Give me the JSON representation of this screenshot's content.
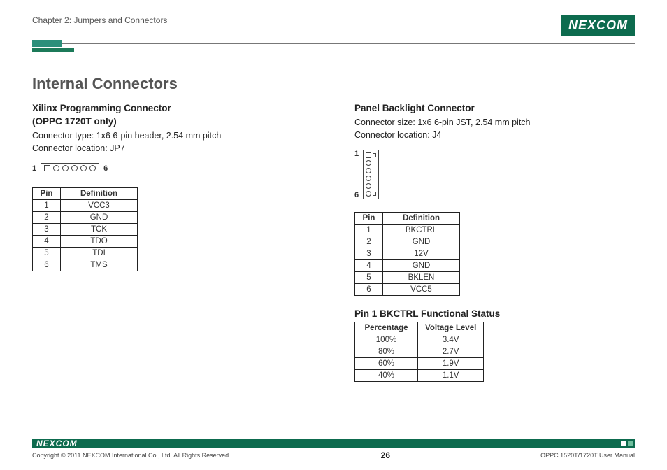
{
  "header": {
    "chapter": "Chapter 2: Jumpers and Connectors",
    "brand": "NEXCOM"
  },
  "section_title": "Internal Connectors",
  "left": {
    "heading_line1": "Xilinx Programming Connector",
    "heading_line2": "(OPPC 1720T only)",
    "desc_line1": "Connector type: 1x6 6-pin header, 2.54 mm pitch",
    "desc_line2": "Connector location: JP7",
    "diag_left_label": "1",
    "diag_right_label": "6",
    "table": {
      "col_pin": "Pin",
      "col_def": "Definition",
      "rows": [
        {
          "pin": "1",
          "def": "VCC3"
        },
        {
          "pin": "2",
          "def": "GND"
        },
        {
          "pin": "3",
          "def": "TCK"
        },
        {
          "pin": "4",
          "def": "TDO"
        },
        {
          "pin": "5",
          "def": "TDI"
        },
        {
          "pin": "6",
          "def": "TMS"
        }
      ]
    }
  },
  "right": {
    "heading": "Panel Backlight Connector",
    "desc_line1": "Connector size: 1x6 6-pin JST, 2.54 mm pitch",
    "desc_line2": "Connector location: J4",
    "diag_top_label": "1",
    "diag_bottom_label": "6",
    "table": {
      "col_pin": "Pin",
      "col_def": "Definition",
      "rows": [
        {
          "pin": "1",
          "def": "BKCTRL"
        },
        {
          "pin": "2",
          "def": "GND"
        },
        {
          "pin": "3",
          "def": "12V"
        },
        {
          "pin": "4",
          "def": "GND"
        },
        {
          "pin": "5",
          "def": "BKLEN"
        },
        {
          "pin": "6",
          "def": "VCC5"
        }
      ]
    },
    "status_heading": "Pin 1 BKCTRL Functional Status",
    "status_table": {
      "col_pct": "Percentage",
      "col_volt": "Voltage Level",
      "rows": [
        {
          "pct": "100%",
          "volt": "3.4V"
        },
        {
          "pct": "80%",
          "volt": "2.7V"
        },
        {
          "pct": "60%",
          "volt": "1.9V"
        },
        {
          "pct": "40%",
          "volt": "1.1V"
        }
      ]
    }
  },
  "footer": {
    "brand": "NEXCOM",
    "copyright": "Copyright © 2011 NEXCOM International Co., Ltd. All Rights Reserved.",
    "page": "26",
    "doc": "OPPC 1520T/1720T User Manual"
  }
}
